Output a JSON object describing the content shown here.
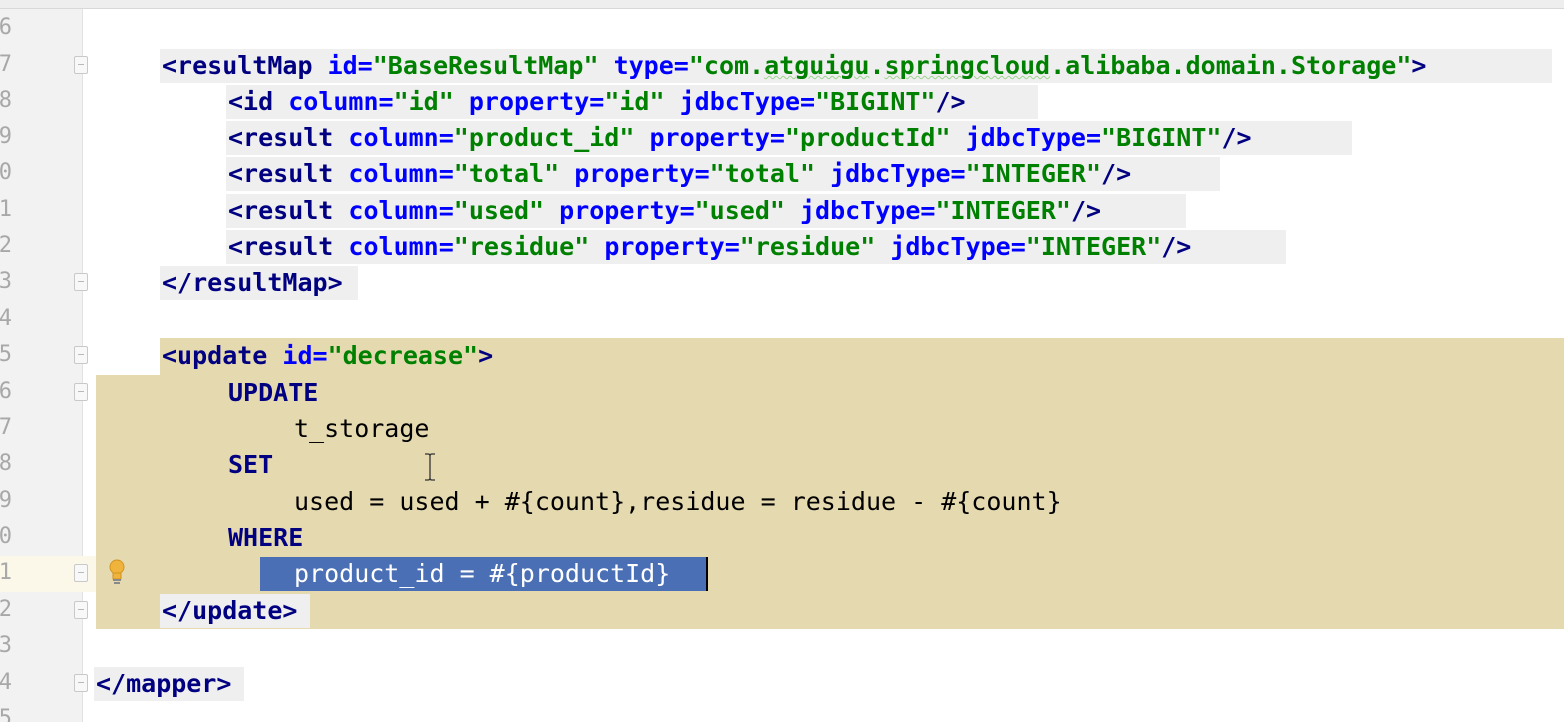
{
  "editor": {
    "language": "XML",
    "colors": {
      "tag": "#000080",
      "attribute": "#0000ff",
      "value": "#008000",
      "keyword": "#000080",
      "highlight": "#e5d9b0",
      "selection": "#4a6fb5"
    },
    "lines": [
      {
        "number": "6"
      },
      {
        "number": "7",
        "tag_open": "<resultMap",
        "attr1": "id=",
        "val1": "\"BaseResultMap\"",
        "attr2": "type=",
        "val2_q1": "\"",
        "val2_a": "com.",
        "val2_b": "atguigu",
        "val2_c": ".",
        "val2_d": "springcloud",
        "val2_e": ".alibaba.domain.Storage",
        "val2_q2": "\"",
        "close": ">"
      },
      {
        "number": "8",
        "tag_open": "<id",
        "attr1": "column=",
        "val1": "\"id\"",
        "attr2": "property=",
        "val2": "\"id\"",
        "attr3": "jdbcType=",
        "val3": "\"BIGINT\"",
        "close": "/>"
      },
      {
        "number": "9",
        "tag_open": "<result",
        "attr1": "column=",
        "val1": "\"product_id\"",
        "attr2": "property=",
        "val2": "\"productId\"",
        "attr3": "jdbcType=",
        "val3": "\"BIGINT\"",
        "close": "/>"
      },
      {
        "number": "0",
        "tag_open": "<result",
        "attr1": "column=",
        "val1": "\"total\"",
        "attr2": "property=",
        "val2": "\"total\"",
        "attr3": "jdbcType=",
        "val3": "\"INTEGER\"",
        "close": "/>"
      },
      {
        "number": "1",
        "tag_open": "<result",
        "attr1": "column=",
        "val1": "\"used\"",
        "attr2": "property=",
        "val2": "\"used\"",
        "attr3": "jdbcType=",
        "val3": "\"INTEGER\"",
        "close": "/>"
      },
      {
        "number": "2",
        "tag_open": "<result",
        "attr1": "column=",
        "val1": "\"residue\"",
        "attr2": "property=",
        "val2": "\"residue\"",
        "attr3": "jdbcType=",
        "val3": "\"INTEGER\"",
        "close": "/>"
      },
      {
        "number": "3",
        "tag_close": "</resultMap>"
      },
      {
        "number": "4"
      },
      {
        "number": "5",
        "tag_open": "<update",
        "attr1": "id=",
        "val1": "\"decrease\"",
        "close": ">"
      },
      {
        "number": "6",
        "keyword": "UPDATE"
      },
      {
        "number": "7",
        "text": "t_storage"
      },
      {
        "number": "8",
        "keyword": "SET"
      },
      {
        "number": "9",
        "text": "used = used + #{count},residue = residue - #{count}"
      },
      {
        "number": "0",
        "keyword": "WHERE"
      },
      {
        "number": "1",
        "selected": "product_id = #{productId}"
      },
      {
        "number": "2",
        "tag_close": "</update>"
      },
      {
        "number": "3"
      },
      {
        "number": "4",
        "tag_close": "</mapper>"
      },
      {
        "number": "5"
      }
    ]
  }
}
